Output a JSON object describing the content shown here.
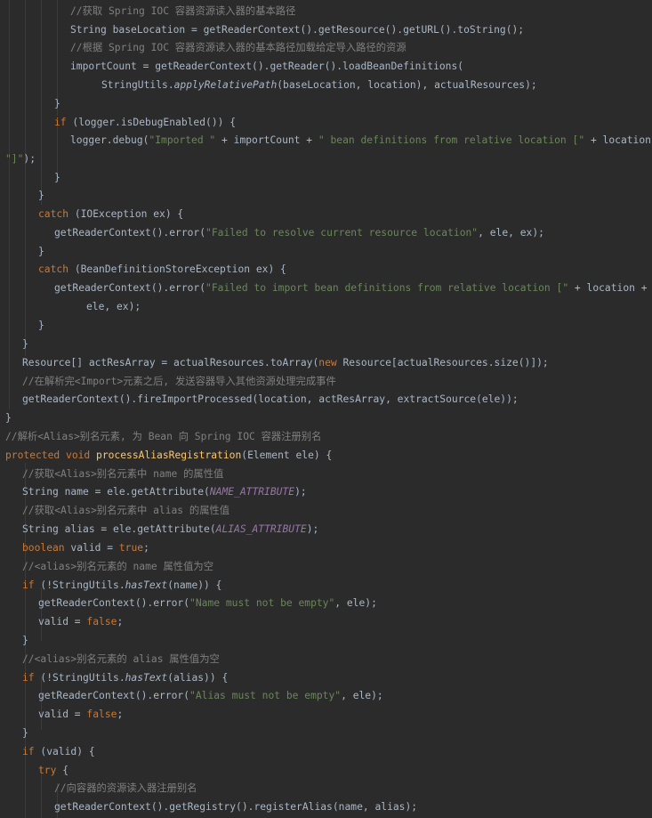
{
  "code": {
    "lines": [
      {
        "t": 12.5,
        "segs": [
          [
            "cmt",
            "//获取 Spring IOC 容器资源读入器的基本路径"
          ]
        ]
      },
      {
        "t": 33.5,
        "segs": [
          [
            "txt",
            "String baseLocation = getReaderContext().getResource().getURL().toString();"
          ]
        ]
      },
      {
        "t": 53.5,
        "segs": [
          [
            "cmt",
            "//根据 Spring IOC 容器资源读入器的基本路径加载给定导入路径的资源"
          ]
        ]
      },
      {
        "t": 74.5,
        "segs": [
          [
            "txt",
            "importCount = getReaderContext().getReader().loadBeanDefinitions("
          ]
        ]
      },
      {
        "t": 95.5,
        "segs": [
          [
            "txt",
            "StringUtils."
          ],
          [
            "it",
            "applyRelativePath"
          ],
          [
            "txt",
            "(baseLocation, location), actualResources);"
          ]
        ]
      },
      {
        "t": 116.5,
        "segs": [
          [
            "txt",
            "}"
          ]
        ]
      },
      {
        "t": 137.5,
        "segs": [
          [
            "kw",
            "if "
          ],
          [
            "txt",
            "(logger.isDebugEnabled()) {"
          ]
        ]
      },
      {
        "t": 157.5,
        "segs": [
          [
            "txt",
            "logger.debug("
          ],
          [
            "str",
            "\"Imported \""
          ],
          [
            "txt",
            " + importCount + "
          ],
          [
            "str",
            "\" bean definitions from relative location [\""
          ],
          [
            "txt",
            " + location +"
          ]
        ]
      },
      {
        "t": 178.5,
        "segs": [
          [
            "str",
            "\"]\""
          ],
          [
            "txt",
            ");"
          ]
        ]
      },
      {
        "t": 199.5,
        "segs": [
          [
            "txt",
            "}"
          ]
        ]
      },
      {
        "t": 219.5,
        "segs": [
          [
            "txt",
            "}"
          ]
        ]
      },
      {
        "t": 240.5,
        "segs": [
          [
            "kw",
            "catch "
          ],
          [
            "txt",
            "(IOException ex) {"
          ]
        ]
      },
      {
        "t": 261.5,
        "segs": [
          [
            "txt",
            "getReaderContext().error("
          ],
          [
            "str",
            "\"Failed to resolve current resource location\""
          ],
          [
            "txt",
            ", ele, ex);"
          ]
        ]
      },
      {
        "t": 282.5,
        "segs": [
          [
            "txt",
            "}"
          ]
        ]
      },
      {
        "t": 302.5,
        "segs": [
          [
            "kw",
            "catch "
          ],
          [
            "txt",
            "(BeanDefinitionStoreException ex) {"
          ]
        ]
      },
      {
        "t": 323.5,
        "segs": [
          [
            "txt",
            "getReaderContext().error("
          ],
          [
            "str",
            "\"Failed to import bean definitions from relative location [\""
          ],
          [
            "txt",
            " + location + "
          ],
          [
            "str",
            "\"]\""
          ],
          [
            "txt",
            ","
          ]
        ]
      },
      {
        "t": 344.5,
        "segs": [
          [
            "txt",
            "ele, ex);"
          ]
        ]
      },
      {
        "t": 365.5,
        "segs": [
          [
            "txt",
            "}"
          ]
        ]
      },
      {
        "t": 386.5,
        "segs": [
          [
            "txt",
            "}"
          ]
        ]
      },
      {
        "t": 407.5,
        "segs": [
          [
            "txt",
            "Resource[] actResArray = actualResources.toArray("
          ],
          [
            "kw",
            "new "
          ],
          [
            "txt",
            "Resource[actualResources.size()]);"
          ]
        ]
      },
      {
        "t": 428.5,
        "segs": [
          [
            "cmt",
            "//在解析完<Import>元素之后, 发送容器导入其他资源处理完成事件"
          ]
        ]
      },
      {
        "t": 448.5,
        "segs": [
          [
            "txt",
            "getReaderContext().fireImportProcessed(location, actResArray, extractSource(ele));"
          ]
        ]
      },
      {
        "t": 469.5,
        "segs": [
          [
            "txt",
            "}"
          ]
        ]
      },
      {
        "t": 490.5,
        "segs": [
          [
            "cmt",
            "//解析<Alias>别名元素, 为 Bean 向 Spring IOC 容器注册别名"
          ]
        ]
      },
      {
        "t": 511.5,
        "segs": [
          [
            "kw",
            "protected void "
          ],
          [
            "fn",
            "processAliasRegistration"
          ],
          [
            "txt",
            "(Element ele) {"
          ]
        ]
      },
      {
        "t": 532.5,
        "segs": [
          [
            "cmt",
            "//获取<Alias>别名元素中 name 的属性值"
          ]
        ]
      },
      {
        "t": 552.5,
        "segs": [
          [
            "txt",
            "String name = ele.getAttribute("
          ],
          [
            "const",
            "NAME_ATTRIBUTE"
          ],
          [
            "txt",
            ");"
          ]
        ]
      },
      {
        "t": 573.5,
        "segs": [
          [
            "cmt",
            "//获取<Alias>别名元素中 alias 的属性值"
          ]
        ]
      },
      {
        "t": 594.5,
        "segs": [
          [
            "txt",
            "String alias = ele.getAttribute("
          ],
          [
            "const",
            "ALIAS_ATTRIBUTE"
          ],
          [
            "txt",
            ");"
          ]
        ]
      },
      {
        "t": 615.5,
        "segs": [
          [
            "kw",
            "boolean "
          ],
          [
            "txt",
            "valid = "
          ],
          [
            "kw",
            "true"
          ],
          [
            "txt",
            ";"
          ]
        ]
      },
      {
        "t": 636.5,
        "segs": [
          [
            "cmt",
            "//<alias>别名元素的 name 属性值为空"
          ]
        ]
      },
      {
        "t": 657.5,
        "segs": [
          [
            "kw",
            "if "
          ],
          [
            "txt",
            "(!StringUtils."
          ],
          [
            "it",
            "hasText"
          ],
          [
            "txt",
            "(name)) {"
          ]
        ]
      },
      {
        "t": 677.5,
        "segs": [
          [
            "txt",
            "getReaderContext().error("
          ],
          [
            "str",
            "\"Name must not be empty\""
          ],
          [
            "txt",
            ", ele);"
          ]
        ]
      },
      {
        "t": 698.5,
        "segs": [
          [
            "txt",
            "valid = "
          ],
          [
            "kw",
            "false"
          ],
          [
            "txt",
            ";"
          ]
        ]
      },
      {
        "t": 719.5,
        "segs": [
          [
            "txt",
            "}"
          ]
        ]
      },
      {
        "t": 740.5,
        "segs": [
          [
            "cmt",
            "//<alias>别名元素的 alias 属性值为空"
          ]
        ]
      },
      {
        "t": 761.5,
        "segs": [
          [
            "kw",
            "if "
          ],
          [
            "txt",
            "(!StringUtils."
          ],
          [
            "it",
            "hasText"
          ],
          [
            "txt",
            "(alias)) {"
          ]
        ]
      },
      {
        "t": 781.5,
        "segs": [
          [
            "txt",
            "getReaderContext().error("
          ],
          [
            "str",
            "\"Alias must not be empty\""
          ],
          [
            "txt",
            ", ele);"
          ]
        ]
      },
      {
        "t": 802.5,
        "segs": [
          [
            "txt",
            "valid = "
          ],
          [
            "kw",
            "false"
          ],
          [
            "txt",
            ";"
          ]
        ]
      },
      {
        "t": 823.5,
        "segs": [
          [
            "txt",
            "}"
          ]
        ]
      },
      {
        "t": 844.5,
        "segs": [
          [
            "kw",
            "if "
          ],
          [
            "txt",
            "(valid) {"
          ]
        ]
      },
      {
        "t": 865.5,
        "segs": [
          [
            "kw",
            "try "
          ],
          [
            "txt",
            "{"
          ]
        ]
      },
      {
        "t": 885.5,
        "segs": [
          [
            "cmt",
            "//向容器的资源读入器注册别名"
          ]
        ]
      },
      {
        "t": 906.5,
        "segs": [
          [
            "txt",
            "getReaderContext().getRegistry().registerAlias(name, alias);"
          ]
        ]
      }
    ]
  },
  "colors": {
    "background": "#2b2b2b",
    "text": "#a9b7c6",
    "keyword": "#cc7832",
    "string": "#6a8759",
    "comment": "#808080",
    "constant": "#9876aa",
    "method_declaration": "#ffc66d"
  }
}
